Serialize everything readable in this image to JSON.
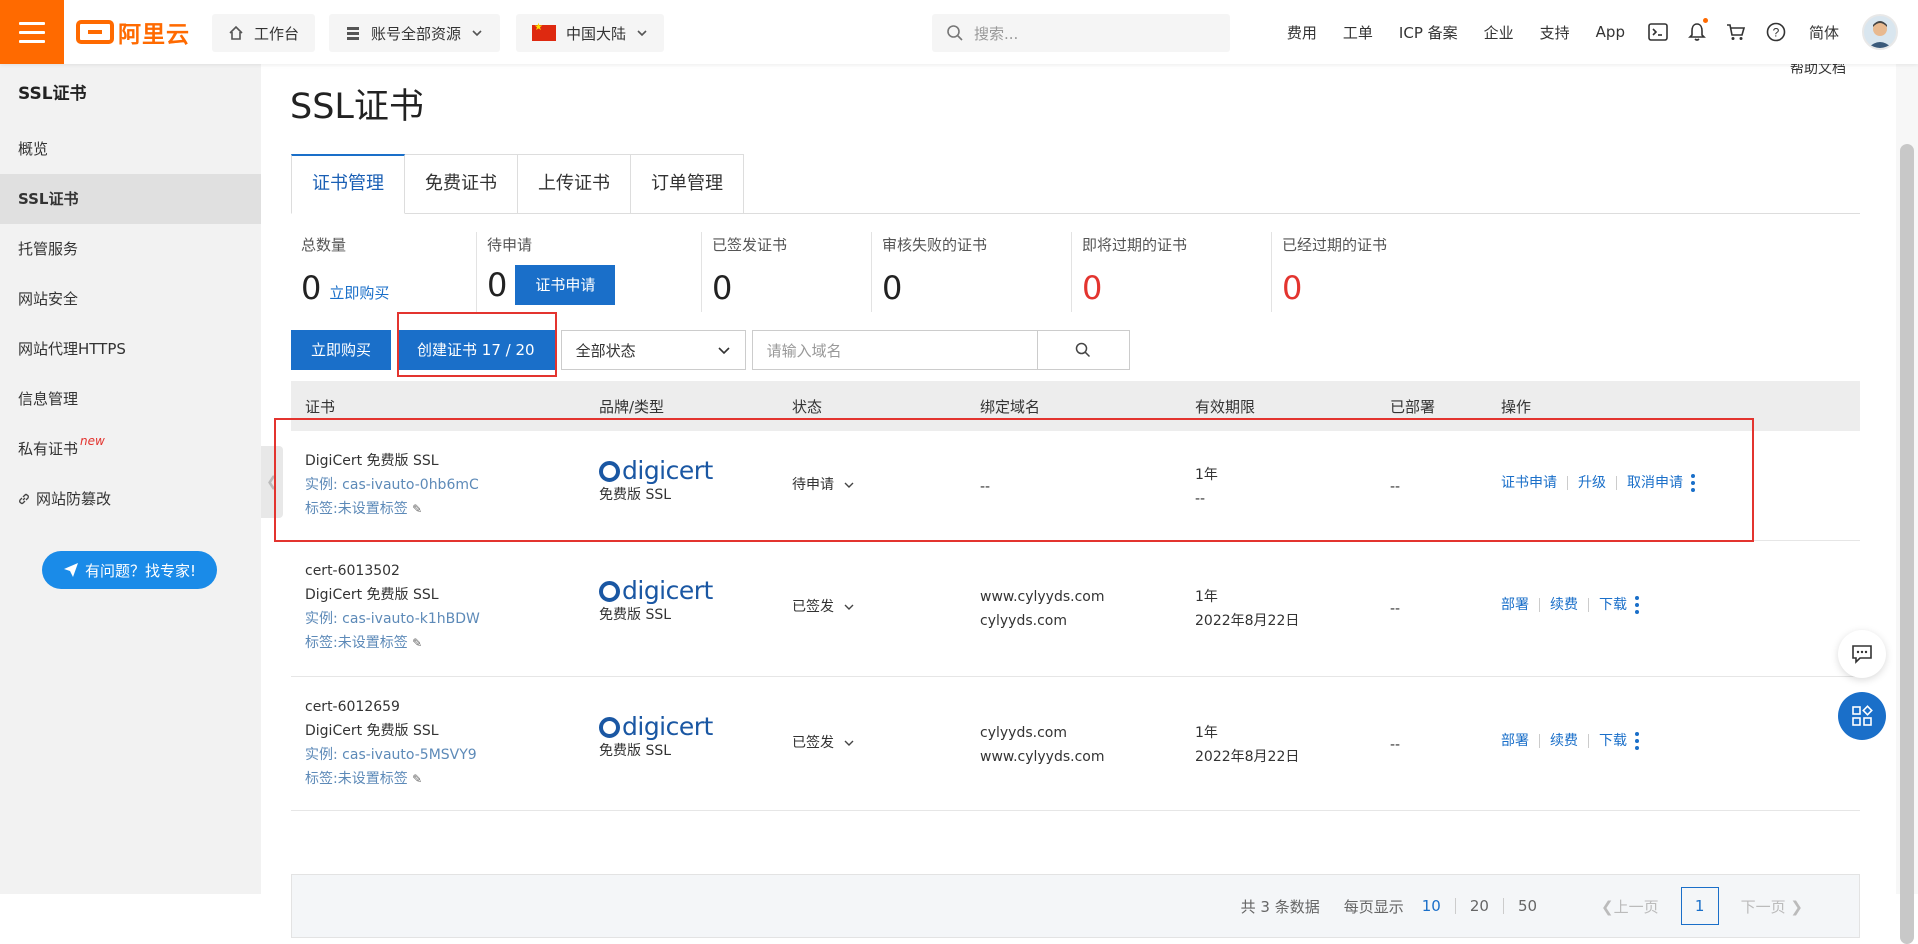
{
  "header": {
    "logo_text": "阿里云",
    "workbench": "工作台",
    "resources": "账号全部资源",
    "region": "中国大陆",
    "search_placeholder": "搜索...",
    "nav": [
      "费用",
      "工单",
      "ICP 备案",
      "企业",
      "支持",
      "App"
    ],
    "lang": "简体"
  },
  "sidebar": {
    "title": "SSL证书",
    "items": [
      {
        "label": "概览"
      },
      {
        "label": "SSL证书"
      },
      {
        "label": "托管服务"
      },
      {
        "label": "网站安全"
      },
      {
        "label": "网站代理HTTPS"
      },
      {
        "label": "信息管理"
      },
      {
        "label": "私有证书",
        "badge": "new"
      },
      {
        "label": "网站防篡改"
      }
    ],
    "expert_btn": "有问题？找专家!"
  },
  "main": {
    "help": "帮助文档",
    "title": "SSL证书",
    "tabs": [
      "证书管理",
      "免费证书",
      "上传证书",
      "订单管理"
    ],
    "stats": [
      {
        "label": "总数量",
        "value": "0",
        "link": "立即购买"
      },
      {
        "label": "待申请",
        "value": "0",
        "button": "证书申请"
      },
      {
        "label": "已签发证书",
        "value": "0"
      },
      {
        "label": "审核失败的证书",
        "value": "0"
      },
      {
        "label": "即将过期的证书",
        "value": "0"
      },
      {
        "label": "已经过期的证书",
        "value": "0"
      }
    ],
    "toolbar": {
      "buy": "立即购买",
      "create": "创建证书 17 / 20",
      "status_select": "全部状态",
      "domain_placeholder": "请输入域名"
    },
    "table": {
      "headers": [
        "证书",
        "品牌/类型",
        "状态",
        "绑定域名",
        "有效期限",
        "已部署",
        "操作"
      ],
      "rows": [
        {
          "name": "",
          "type": "DigiCert 免费版 SSL",
          "instance": "实例: cas-ivauto-0hb6mC",
          "tag": "标签:未设置标签",
          "brand": "digicert",
          "brand_type": "免费版 SSL",
          "status": "待申请",
          "domains": [
            "--"
          ],
          "period": "1年",
          "expiry": "--",
          "deployed": "--",
          "ops": [
            "证书申请",
            "升级",
            "取消申请"
          ]
        },
        {
          "name": "cert-6013502",
          "type": "DigiCert 免费版 SSL",
          "instance": "实例: cas-ivauto-k1hBDW",
          "tag": "标签:未设置标签",
          "brand": "digicert",
          "brand_type": "免费版 SSL",
          "status": "已签发",
          "domains": [
            "www.cylyyds.com",
            "cylyyds.com"
          ],
          "period": "1年",
          "expiry": "2022年8月22日",
          "deployed": "--",
          "ops": [
            "部署",
            "续费",
            "下载"
          ]
        },
        {
          "name": "cert-6012659",
          "type": "DigiCert 免费版 SSL",
          "instance": "实例: cas-ivauto-5MSVY9",
          "tag": "标签:未设置标签",
          "brand": "digicert",
          "brand_type": "免费版 SSL",
          "status": "已签发",
          "domains": [
            "cylyyds.com",
            "www.cylyyds.com"
          ],
          "period": "1年",
          "expiry": "2022年8月22日",
          "deployed": "--",
          "ops": [
            "部署",
            "续费",
            "下载"
          ]
        }
      ]
    },
    "pager": {
      "total": "共 3 条数据",
      "per_page_label": "每页显示",
      "sizes": [
        "10",
        "20",
        "50"
      ],
      "prev": "上一页",
      "current": "1",
      "next": "下一页"
    }
  },
  "colors": {
    "brand_orange": "#ff6a00",
    "primary_blue": "#1a6fc9",
    "alert_red": "#e3342f"
  },
  "icons": [
    "hamburger-icon",
    "home-icon",
    "stack-icon",
    "chevron-down-icon",
    "flag-cn-icon",
    "search-icon",
    "terminal-icon",
    "bell-icon",
    "cart-icon",
    "help-icon",
    "edit-icon",
    "chat-icon",
    "apps-icon",
    "kebab-icon"
  ]
}
